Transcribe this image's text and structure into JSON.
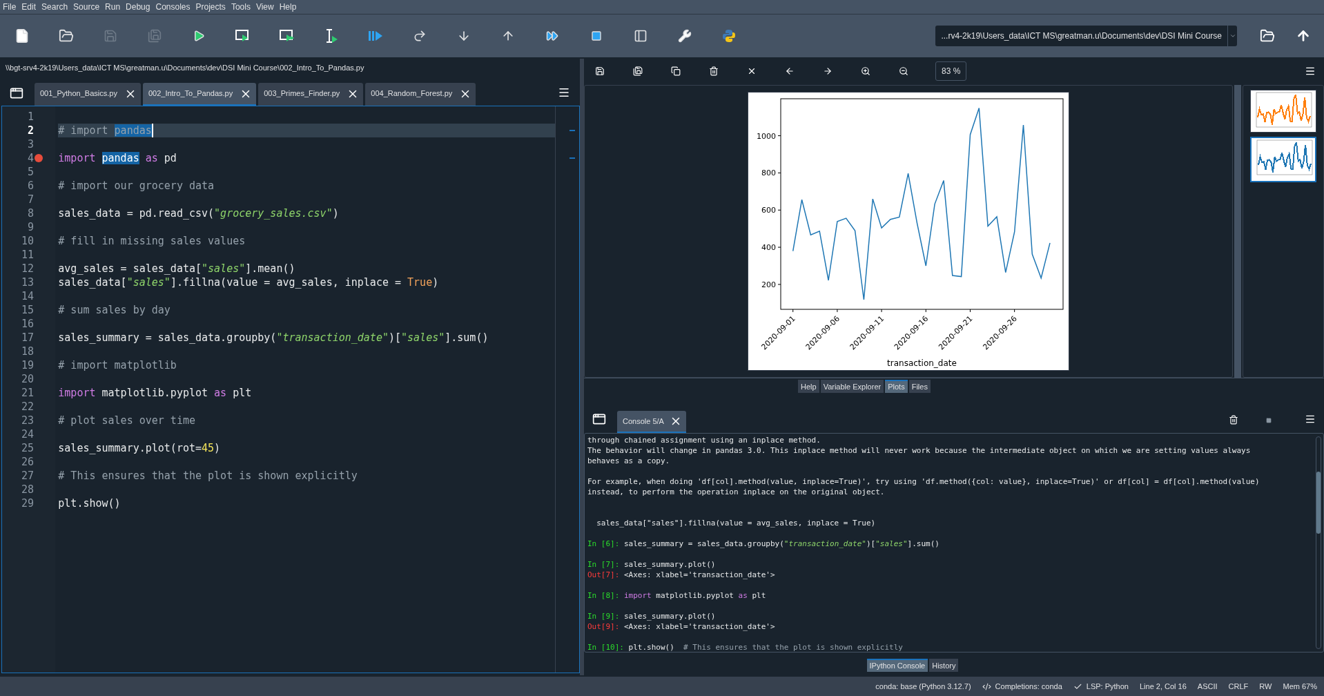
{
  "menu": [
    "File",
    "Edit",
    "Search",
    "Source",
    "Run",
    "Debug",
    "Consoles",
    "Projects",
    "Tools",
    "View",
    "Help"
  ],
  "toolbar": [
    {
      "disabled": false
    },
    {
      "disabled": false
    },
    {
      "disabled": true
    },
    {
      "disabled": true
    },
    {
      "disabled": false
    },
    {
      "disabled": false
    },
    {
      "disabled": false
    },
    {
      "disabled": false
    },
    {
      "disabled": false
    },
    {
      "disabled": false
    },
    {
      "disabled": false
    },
    {
      "disabled": false
    },
    {
      "disabled": false
    },
    {
      "disabled": false
    },
    {
      "disabled": false
    },
    {
      "disabled": false
    },
    {
      "disabled": false
    }
  ],
  "working_directory": "...rv4-2k19\\Users_data\\ICT MS\\greatman.u\\Documents\\dev\\DSI Mini Course",
  "editor": {
    "path": "\\\\bgt-srv4-2k19\\Users_data\\ICT MS\\greatman.u\\Documents\\dev\\DSI Mini Course\\002_Intro_To_Pandas.py",
    "tabs": [
      {
        "label": "001_Python_Basics.py",
        "selected": false
      },
      {
        "label": "002_Intro_To_Pandas.py",
        "selected": true
      },
      {
        "label": "003_Primes_Finder.py",
        "selected": false
      },
      {
        "label": "004_Random_Forest.py",
        "selected": false
      }
    ],
    "lines": [
      {
        "number": "1",
        "current": false,
        "breakpoint": false
      },
      {
        "number": "2",
        "current": true,
        "breakpoint": false,
        "tokens": [
          {
            "kind": "comment",
            "text": "# import "
          },
          {
            "kind": "comment-match",
            "text": "pandas"
          }
        ]
      },
      {
        "number": "3",
        "current": false,
        "breakpoint": false
      },
      {
        "number": "4",
        "current": false,
        "breakpoint": true,
        "tokens": [
          {
            "kind": "keyword",
            "text": "import "
          },
          {
            "kind": "match",
            "text": "pandas"
          },
          {
            "kind": "keyword",
            "text": " as"
          },
          {
            "kind": "plain",
            "text": " pd"
          }
        ]
      },
      {
        "number": "5",
        "current": false,
        "breakpoint": false
      },
      {
        "number": "6",
        "current": false,
        "breakpoint": false,
        "tokens": [
          {
            "kind": "comment",
            "text": "# import our grocery data"
          }
        ]
      },
      {
        "number": "7",
        "current": false,
        "breakpoint": false
      },
      {
        "number": "8",
        "current": false,
        "breakpoint": false,
        "tokens": [
          {
            "kind": "plain",
            "text": "sales_data = pd.read_csv("
          },
          {
            "kind": "string",
            "text": "\"grocery_sales.csv\""
          },
          {
            "kind": "plain",
            "text": ")"
          }
        ]
      },
      {
        "number": "9",
        "current": false,
        "breakpoint": false
      },
      {
        "number": "10",
        "current": false,
        "breakpoint": false,
        "tokens": [
          {
            "kind": "comment",
            "text": "# fill in missing sales values"
          }
        ]
      },
      {
        "number": "11",
        "current": false,
        "breakpoint": false
      },
      {
        "number": "12",
        "current": false,
        "breakpoint": false,
        "tokens": [
          {
            "kind": "plain",
            "text": "avg_sales = sales_data["
          },
          {
            "kind": "string",
            "text": "\"sales\""
          },
          {
            "kind": "plain",
            "text": "].mean()"
          }
        ]
      },
      {
        "number": "13",
        "current": false,
        "breakpoint": false,
        "tokens": [
          {
            "kind": "plain",
            "text": "sales_data["
          },
          {
            "kind": "string",
            "text": "\"sales\""
          },
          {
            "kind": "plain",
            "text": "].fillna(value = avg_sales, inplace = "
          },
          {
            "kind": "constant",
            "text": "True"
          },
          {
            "kind": "plain",
            "text": ")"
          }
        ]
      },
      {
        "number": "14",
        "current": false,
        "breakpoint": false
      },
      {
        "number": "15",
        "current": false,
        "breakpoint": false,
        "tokens": [
          {
            "kind": "comment",
            "text": "# sum sales by day"
          }
        ]
      },
      {
        "number": "16",
        "current": false,
        "breakpoint": false
      },
      {
        "number": "17",
        "current": false,
        "breakpoint": false,
        "tokens": [
          {
            "kind": "plain",
            "text": "sales_summary = sales_data.groupby("
          },
          {
            "kind": "string",
            "text": "\"transaction_date\""
          },
          {
            "kind": "plain",
            "text": ")["
          },
          {
            "kind": "string",
            "text": "\"sales\""
          },
          {
            "kind": "plain",
            "text": "].sum()"
          }
        ]
      },
      {
        "number": "18",
        "current": false,
        "breakpoint": false
      },
      {
        "number": "19",
        "current": false,
        "breakpoint": false,
        "tokens": [
          {
            "kind": "comment",
            "text": "# import matplotlib"
          }
        ]
      },
      {
        "number": "20",
        "current": false,
        "breakpoint": false
      },
      {
        "number": "21",
        "current": false,
        "breakpoint": false,
        "tokens": [
          {
            "kind": "keyword",
            "text": "import"
          },
          {
            "kind": "plain",
            "text": " matplotlib.pyplot "
          },
          {
            "kind": "keyword",
            "text": "as"
          },
          {
            "kind": "plain",
            "text": " plt"
          }
        ]
      },
      {
        "number": "22",
        "current": false,
        "breakpoint": false
      },
      {
        "number": "23",
        "current": false,
        "breakpoint": false,
        "tokens": [
          {
            "kind": "comment",
            "text": "# plot sales over time"
          }
        ]
      },
      {
        "number": "24",
        "current": false,
        "breakpoint": false
      },
      {
        "number": "25",
        "current": false,
        "breakpoint": false,
        "tokens": [
          {
            "kind": "plain",
            "text": "sales_summary.plot(rot="
          },
          {
            "kind": "number",
            "text": "45"
          },
          {
            "kind": "plain",
            "text": ")"
          }
        ]
      },
      {
        "number": "26",
        "current": false,
        "breakpoint": false
      },
      {
        "number": "27",
        "current": false,
        "breakpoint": false,
        "tokens": [
          {
            "kind": "comment",
            "text": "# This ensures that the plot is shown explicitly"
          }
        ]
      },
      {
        "number": "28",
        "current": false,
        "breakpoint": false
      },
      {
        "number": "29",
        "current": false,
        "breakpoint": false,
        "tokens": [
          {
            "kind": "plain",
            "text": "plt.show()"
          }
        ]
      }
    ]
  },
  "plots": {
    "zoom": "83 %",
    "chart_data": {
      "type": "line",
      "xlabel": "transaction_date",
      "categories": [
        "2020-09-01",
        null,
        null,
        null,
        null,
        "2020-09-06",
        null,
        null,
        null,
        null,
        "2020-09-11",
        null,
        null,
        null,
        null,
        "2020-09-16",
        null,
        null,
        null,
        null,
        "2020-09-21",
        null,
        null,
        null,
        null,
        "2020-09-26",
        null,
        null,
        null,
        null
      ],
      "ylim": [
        66,
        1199
      ],
      "yticks": [
        200,
        400,
        600,
        800,
        1000
      ],
      "series": [
        {
          "color": "#1f77b4",
          "values": [
            379,
            656,
            467,
            487,
            222,
            538,
            556,
            489,
            118,
            660,
            504,
            550,
            562,
            797,
            532,
            300,
            632,
            759,
            248,
            242,
            1006,
            1149,
            514,
            564,
            264,
            483,
            1058,
            363,
            234,
            423
          ]
        }
      ]
    },
    "thumbnails": [
      {
        "selected": false,
        "color": "#ff7f0e"
      },
      {
        "selected": true,
        "color": "#1f77b4"
      }
    ],
    "pane_tabs": [
      {
        "label": "Help",
        "selected": false
      },
      {
        "label": "Variable Explorer",
        "selected": false
      },
      {
        "label": "Plots",
        "selected": true
      },
      {
        "label": "Files",
        "selected": false
      }
    ]
  },
  "console": {
    "tab": "Console 5/A",
    "blocks": [
      {
        "kind": "output",
        "lines": [
          [
            {
              "kind": "plain",
              "text": "through chained assignment using an inplace method."
            }
          ],
          [
            {
              "kind": "plain",
              "text": "The behavior will change in pandas 3.0. This inplace method will never work because the intermediate object on which we are setting values always"
            }
          ],
          [
            {
              "kind": "plain",
              "text": "behaves as a copy."
            }
          ]
        ]
      },
      {
        "kind": "output",
        "lines": [
          [
            {
              "kind": "plain",
              "text": "For example, when doing 'df[col].method(value, inplace=True)', try using 'df.method({col: value}, inplace=True)' or df[col] = df[col].method(value)"
            }
          ],
          [
            {
              "kind": "plain",
              "text": "instead, to perform the operation inplace on the original object."
            }
          ]
        ]
      },
      {
        "kind": "source",
        "lines": [
          [
            {
              "kind": "plain",
              "text": "  sales_data[\"sales\"].fillna(value = avg_sales, inplace = True)"
            }
          ]
        ]
      },
      {
        "kind": "output",
        "lines": [
          [
            {
              "kind": "in",
              "text": "In [6]: "
            },
            {
              "kind": "plain",
              "text": "sales_summary = sales_data.groupby("
            },
            {
              "kind": "string",
              "text": "\"transaction_date\""
            },
            {
              "kind": "plain",
              "text": ")["
            },
            {
              "kind": "string",
              "text": "\"sales\""
            },
            {
              "kind": "plain",
              "text": "].sum()"
            }
          ]
        ]
      },
      {
        "kind": "output",
        "lines": [
          [
            {
              "kind": "in",
              "text": "In [7]: "
            },
            {
              "kind": "plain",
              "text": "sales_summary.plot()"
            }
          ],
          [
            {
              "kind": "out",
              "text": "Out[7]: "
            },
            {
              "kind": "plain",
              "text": "<Axes: xlabel='transaction_date'>"
            }
          ]
        ]
      },
      {
        "kind": "output",
        "lines": [
          [
            {
              "kind": "in",
              "text": "In [8]: "
            },
            {
              "kind": "keyword",
              "text": "import"
            },
            {
              "kind": "plain",
              "text": " matplotlib.pyplot "
            },
            {
              "kind": "keyword",
              "text": "as"
            },
            {
              "kind": "plain",
              "text": " plt"
            }
          ]
        ]
      },
      {
        "kind": "output",
        "lines": [
          [
            {
              "kind": "in",
              "text": "In [9]: "
            },
            {
              "kind": "plain",
              "text": "sales_summary.plot()"
            }
          ],
          [
            {
              "kind": "out",
              "text": "Out[9]: "
            },
            {
              "kind": "plain",
              "text": "<Axes: xlabel='transaction_date'>"
            }
          ]
        ]
      },
      {
        "kind": "output",
        "lines": [
          [
            {
              "kind": "in",
              "text": "In [10]: "
            },
            {
              "kind": "plain",
              "text": "plt.show()  "
            },
            {
              "kind": "comment",
              "text": "# This ensures that the plot is shown explicitly"
            }
          ]
        ]
      }
    ],
    "tabs": [
      {
        "label": "IPython Console",
        "selected": true
      },
      {
        "label": "History",
        "selected": false
      }
    ]
  },
  "status_bar": [
    {
      "kind": "text",
      "text": "conda: base (Python 3.12.7)"
    },
    {
      "kind": "completions",
      "text": "Completions: conda"
    },
    {
      "kind": "check",
      "text": "LSP: Python"
    },
    {
      "kind": "text",
      "text": "Line 2, Col 16"
    },
    {
      "kind": "text",
      "text": "ASCII"
    },
    {
      "kind": "text",
      "text": "CRLF"
    },
    {
      "kind": "text",
      "text": "RW"
    },
    {
      "kind": "text",
      "text": "Mem 67%"
    }
  ]
}
